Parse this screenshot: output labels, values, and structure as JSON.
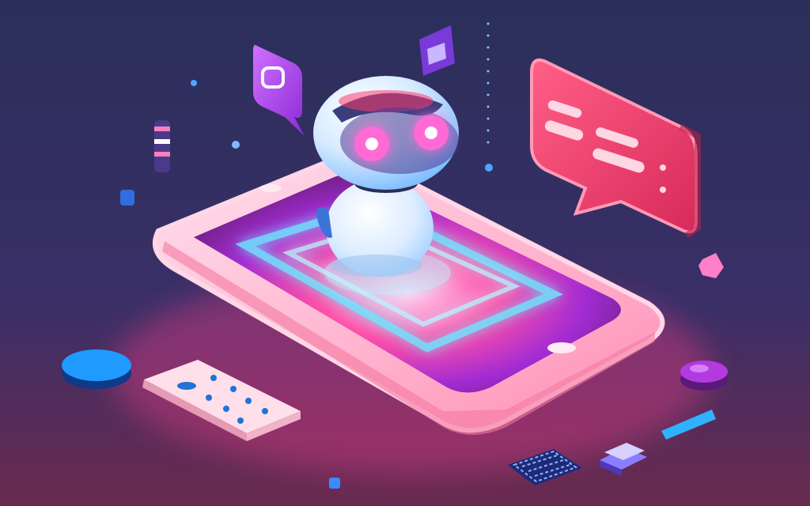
{
  "scene": {
    "subject": "robot-on-smartphone",
    "colors": {
      "bg_top": "#2a2f5a",
      "bg_bottom": "#6a2a4f",
      "phone_frame": "#f6c1d1",
      "screen_glow": "#ff4fa8",
      "screen_cyan": "#6ee7ff",
      "bubble_pink": "#f2436f",
      "bubble_text": "#ffd6e3",
      "robot_white": "#e9f4ff",
      "robot_eye": "#ff6ad5",
      "accent_blue": "#1f9bff",
      "accent_purple": "#b23adf"
    },
    "icons": [
      "robot-icon",
      "smartphone-icon",
      "chat-bubble-icon",
      "keypad-icon",
      "keyboard-icon"
    ]
  }
}
